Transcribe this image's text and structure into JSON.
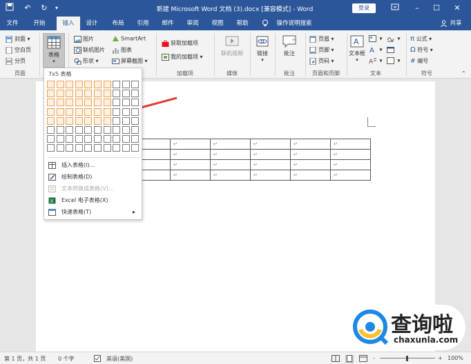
{
  "titlebar": {
    "title": "新建 Microsoft Word 文档 (3).docx [兼容模式] - Word",
    "login": "登录",
    "icons": [
      "save-icon",
      "undo-icon",
      "redo-icon",
      "quick-access-dropdown-icon"
    ],
    "controls": [
      "ribbon-display-icon",
      "minimize-icon",
      "restore-icon",
      "close-icon"
    ]
  },
  "tabs": {
    "file": "文件",
    "home": "开始",
    "insert": "插入",
    "design": "设计",
    "layout": "布局",
    "references": "引用",
    "mailings": "邮件",
    "review": "审阅",
    "view": "视图",
    "help": "帮助",
    "tell_me": "操作说明搜索",
    "share": "共享"
  },
  "ribbon": {
    "pages": {
      "cover": "封面",
      "blank": "空白页",
      "break": "分页",
      "label": "页面"
    },
    "table": {
      "label": "表格"
    },
    "illustrations": {
      "pictures": "图片",
      "online_pictures": "联机图片",
      "shapes": "形状",
      "smartart": "SmartArt",
      "chart": "图表",
      "screenshot": "屏幕截图"
    },
    "addins": {
      "get": "获取加载项",
      "my": "我的加载项",
      "label": "加载项"
    },
    "media": {
      "online_video": "联机视频",
      "label": "媒体"
    },
    "links": {
      "link": "链接"
    },
    "comments": {
      "comment": "批注",
      "label": "批注"
    },
    "header_footer": {
      "header": "页眉",
      "footer": "页脚",
      "page_number": "页码",
      "label": "页眉和页脚"
    },
    "text": {
      "textbox": "文本框",
      "label": "文本"
    },
    "symbols": {
      "equation": "公式",
      "symbol": "符号",
      "number": "编号",
      "label": "符号"
    }
  },
  "dropdown": {
    "title": "7x5 表格",
    "grid_cols": 10,
    "grid_rows": 8,
    "selected_cols": 7,
    "selected_rows": 5,
    "items": [
      {
        "label": "插入表格(I)...",
        "icon": "insert-table-icon",
        "disabled": false
      },
      {
        "label": "绘制表格(D)",
        "icon": "draw-table-icon",
        "disabled": false
      },
      {
        "label": "文本转换成表格(V)...",
        "icon": "text-to-table-icon",
        "disabled": true
      },
      {
        "label": "Excel 电子表格(X)",
        "icon": "excel-icon",
        "disabled": false
      },
      {
        "label": "快速表格(T)",
        "icon": "quick-table-icon",
        "disabled": false
      }
    ]
  },
  "doc_table": {
    "rows": 4,
    "cols": 6,
    "mark": "↵"
  },
  "statusbar": {
    "page": "第 1 页，共 1 页",
    "words": "0 个字",
    "language": "英语(美国)",
    "zoom": "100%",
    "zoom_minus": "-",
    "zoom_plus": "+"
  },
  "watermark": {
    "brand": "查询啦",
    "site": "chaxunla.com"
  },
  "colors": {
    "accent": "#2b579a",
    "selection": "#f0a050",
    "arrow": "#e53935"
  }
}
